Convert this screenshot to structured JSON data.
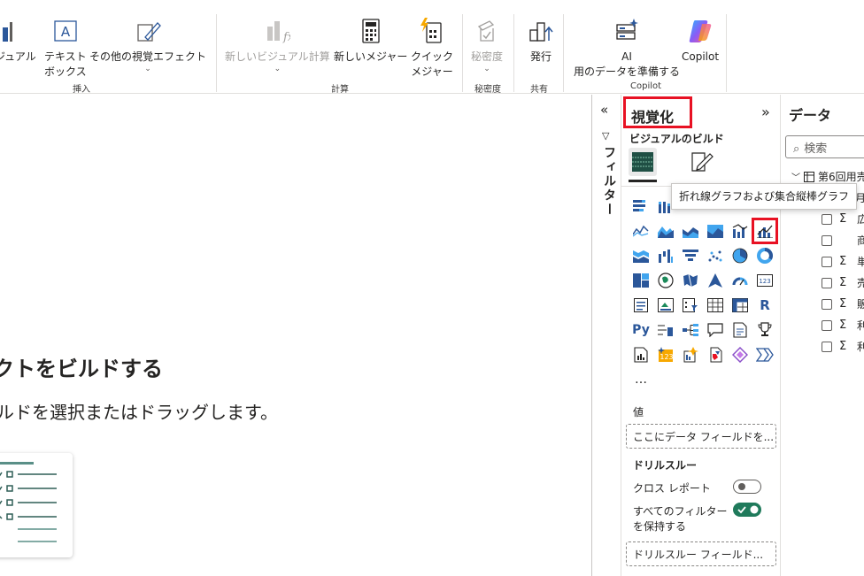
{
  "ribbon": {
    "buttons": {
      "visual": "ジュアル",
      "textbox": "テキスト\nボックス",
      "more_visuals": "その他の視覚エフェクト",
      "new_visual_calc": "新しいビジュアル計算",
      "new_measure": "新しいメジャー",
      "quick_measure": "クイック\nメジャー",
      "sensitivity": "秘密度",
      "publish": "発行",
      "ai_prep": "AI\n用のデータを準備する",
      "copilot": "Copilot"
    },
    "groups": {
      "insert": "挿入",
      "calc": "計算",
      "sensitivity": "秘密度",
      "share": "共有",
      "copilot": "Copilot"
    }
  },
  "canvas": {
    "title": "クトをビルドする",
    "subtitle": "ルドを選択またはドラッグします。"
  },
  "filter_pane": {
    "label": "フィルター"
  },
  "viz_pane": {
    "title": "視覚化",
    "build_label": "ビジュアルのビルド",
    "tooltip": "折れ線グラフおよび集合縦棒グラフ",
    "more": "…",
    "values_label": "値",
    "values_placeholder": "ここにデータ フィールドを...",
    "drillthrough_label": "ドリルスルー",
    "cross_report_label": "クロス レポート",
    "cross_report_on": false,
    "keep_filters_label": "すべてのフィルター\nを保持する",
    "keep_filters_on": true,
    "drill_field_placeholder": "ドリルスルー フィールド..."
  },
  "data_pane": {
    "title": "データ",
    "search_placeholder": "検索",
    "table_name": "第6回用売",
    "fields": [
      {
        "name": "月",
        "sigma": false
      },
      {
        "name": "広",
        "sigma": true
      },
      {
        "name": "商",
        "sigma": false
      },
      {
        "name": "単",
        "sigma": true
      },
      {
        "name": "売",
        "sigma": true
      },
      {
        "name": "販",
        "sigma": true
      },
      {
        "name": "利",
        "sigma": true
      },
      {
        "name": "利",
        "sigma": true
      }
    ]
  },
  "colors": {
    "accent": "#1f7a5b",
    "highlight": "#e81123",
    "icon_blue": "#2b579a",
    "icon_teal": "#1b8a8a"
  }
}
